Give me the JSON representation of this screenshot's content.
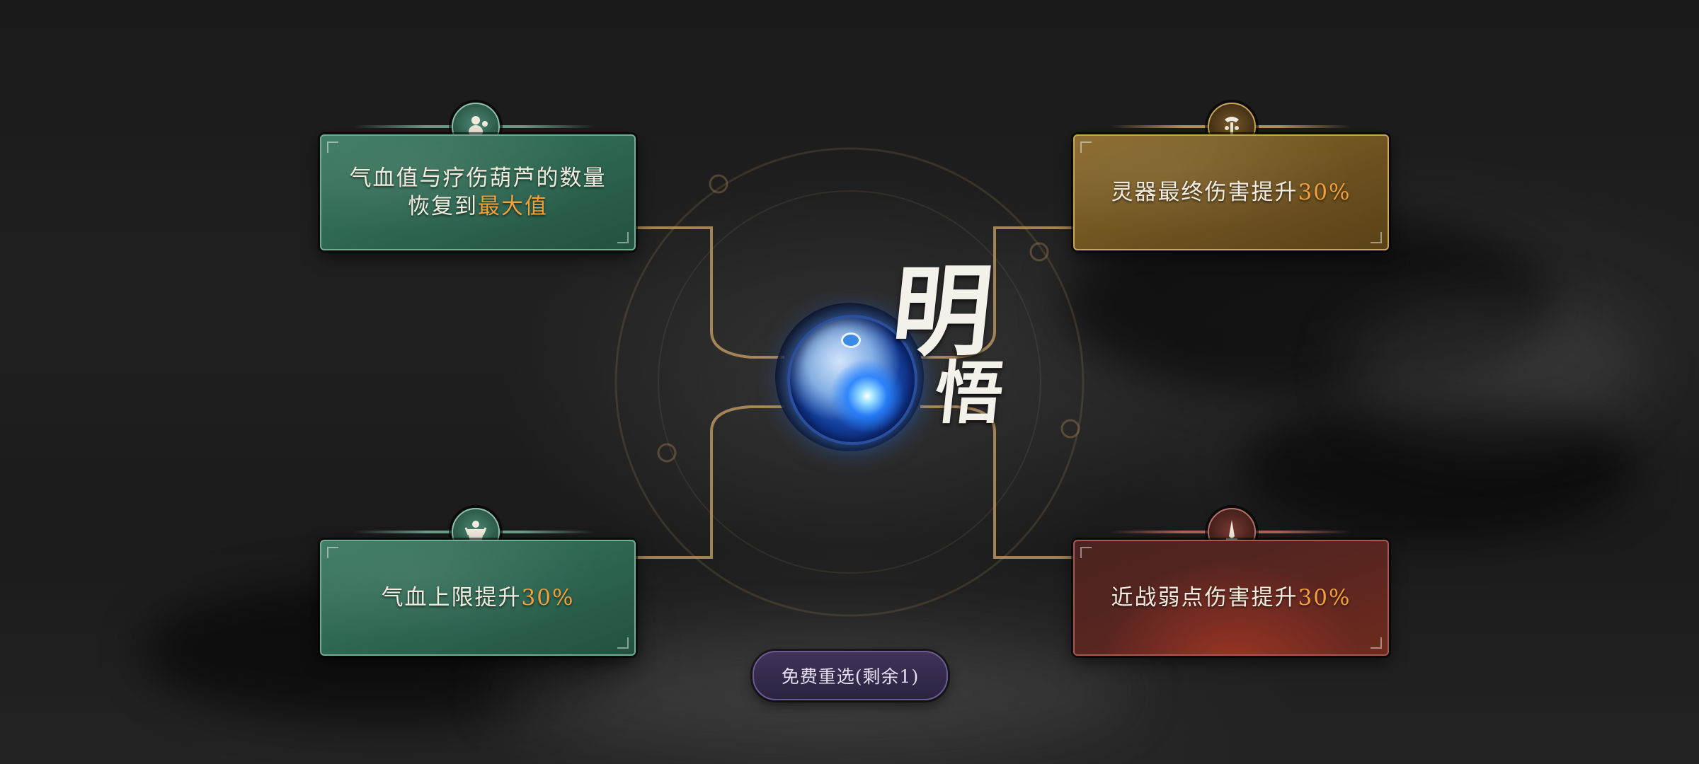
{
  "title": {
    "char1": "明",
    "char2": "悟"
  },
  "cards": [
    {
      "theme": "green",
      "icon": "gourd-figure-icon",
      "line1": "气血值与疗伤葫芦的数量",
      "line2_prefix": "恢复到",
      "line2_highlight": "最大值"
    },
    {
      "theme": "gold",
      "icon": "spirit-artifact-icon",
      "text_prefix": "灵器最终伤害提升",
      "text_highlight": "30%"
    },
    {
      "theme": "green",
      "icon": "muscle-torso-icon",
      "text_prefix": "气血上限提升",
      "text_highlight": "30%"
    },
    {
      "theme": "red",
      "icon": "blade-icon",
      "text_prefix": "近战弱点伤害提升",
      "text_highlight": "30%"
    }
  ],
  "reroll_button": {
    "label": "免费重选(剩余1)"
  },
  "colors": {
    "highlight": "#f2a13a",
    "green_card": "#2c6450",
    "gold_card": "#6e5220",
    "red_card": "#5a2620",
    "connector": "#b8945f"
  }
}
